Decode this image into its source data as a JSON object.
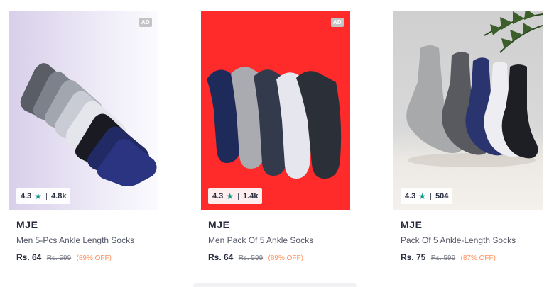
{
  "products": [
    {
      "ad_label": "AD",
      "rating": "4.3",
      "rating_count": "4.8k",
      "brand": "MJE",
      "name": "Men 5-Pcs Ankle Length Socks",
      "price": "Rs. 64",
      "mrp": "Rs. 599",
      "discount": "(89% OFF)"
    },
    {
      "ad_label": "AD",
      "rating": "4.3",
      "rating_count": "1.4k",
      "brand": "MJE",
      "name": "Men Pack Of 5 Ankle Socks",
      "price": "Rs. 64",
      "mrp": "Rs. 599",
      "discount": "(89% OFF)"
    },
    {
      "rating": "4.3",
      "rating_count": "504",
      "brand": "MJE",
      "name": "Pack Of 5 Ankle-Length Socks",
      "price": "Rs. 75",
      "mrp": "Rs. 599",
      "discount": "(87% OFF)"
    }
  ],
  "colors": {
    "star": "#14958f",
    "discount": "#ff905a",
    "card2_background": "#ff2a2a"
  }
}
